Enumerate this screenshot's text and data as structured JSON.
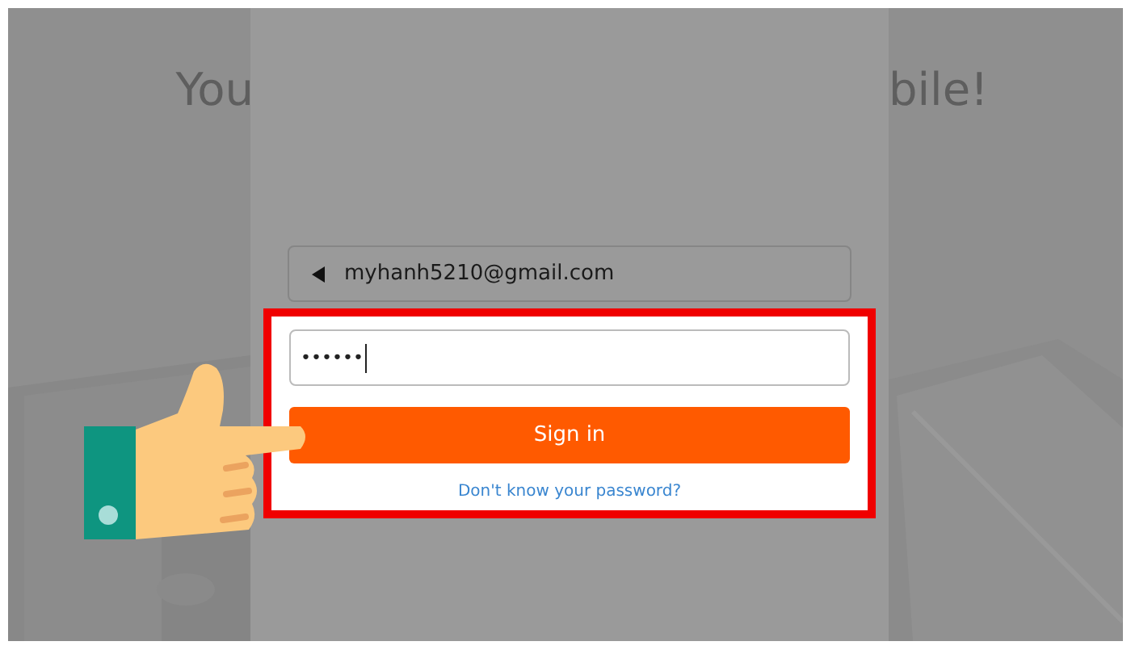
{
  "heading": {
    "left_part": "You",
    "right_part": "bile!"
  },
  "email_field": {
    "value": "myhanh5210@gmail.com"
  },
  "password_field": {
    "value": "••••••",
    "focused": true
  },
  "sign_in_button": {
    "label": "Sign in"
  },
  "forgot_link": {
    "label": "Don't know your password?"
  },
  "annotation": {
    "highlighted": true,
    "pointer": true
  }
}
